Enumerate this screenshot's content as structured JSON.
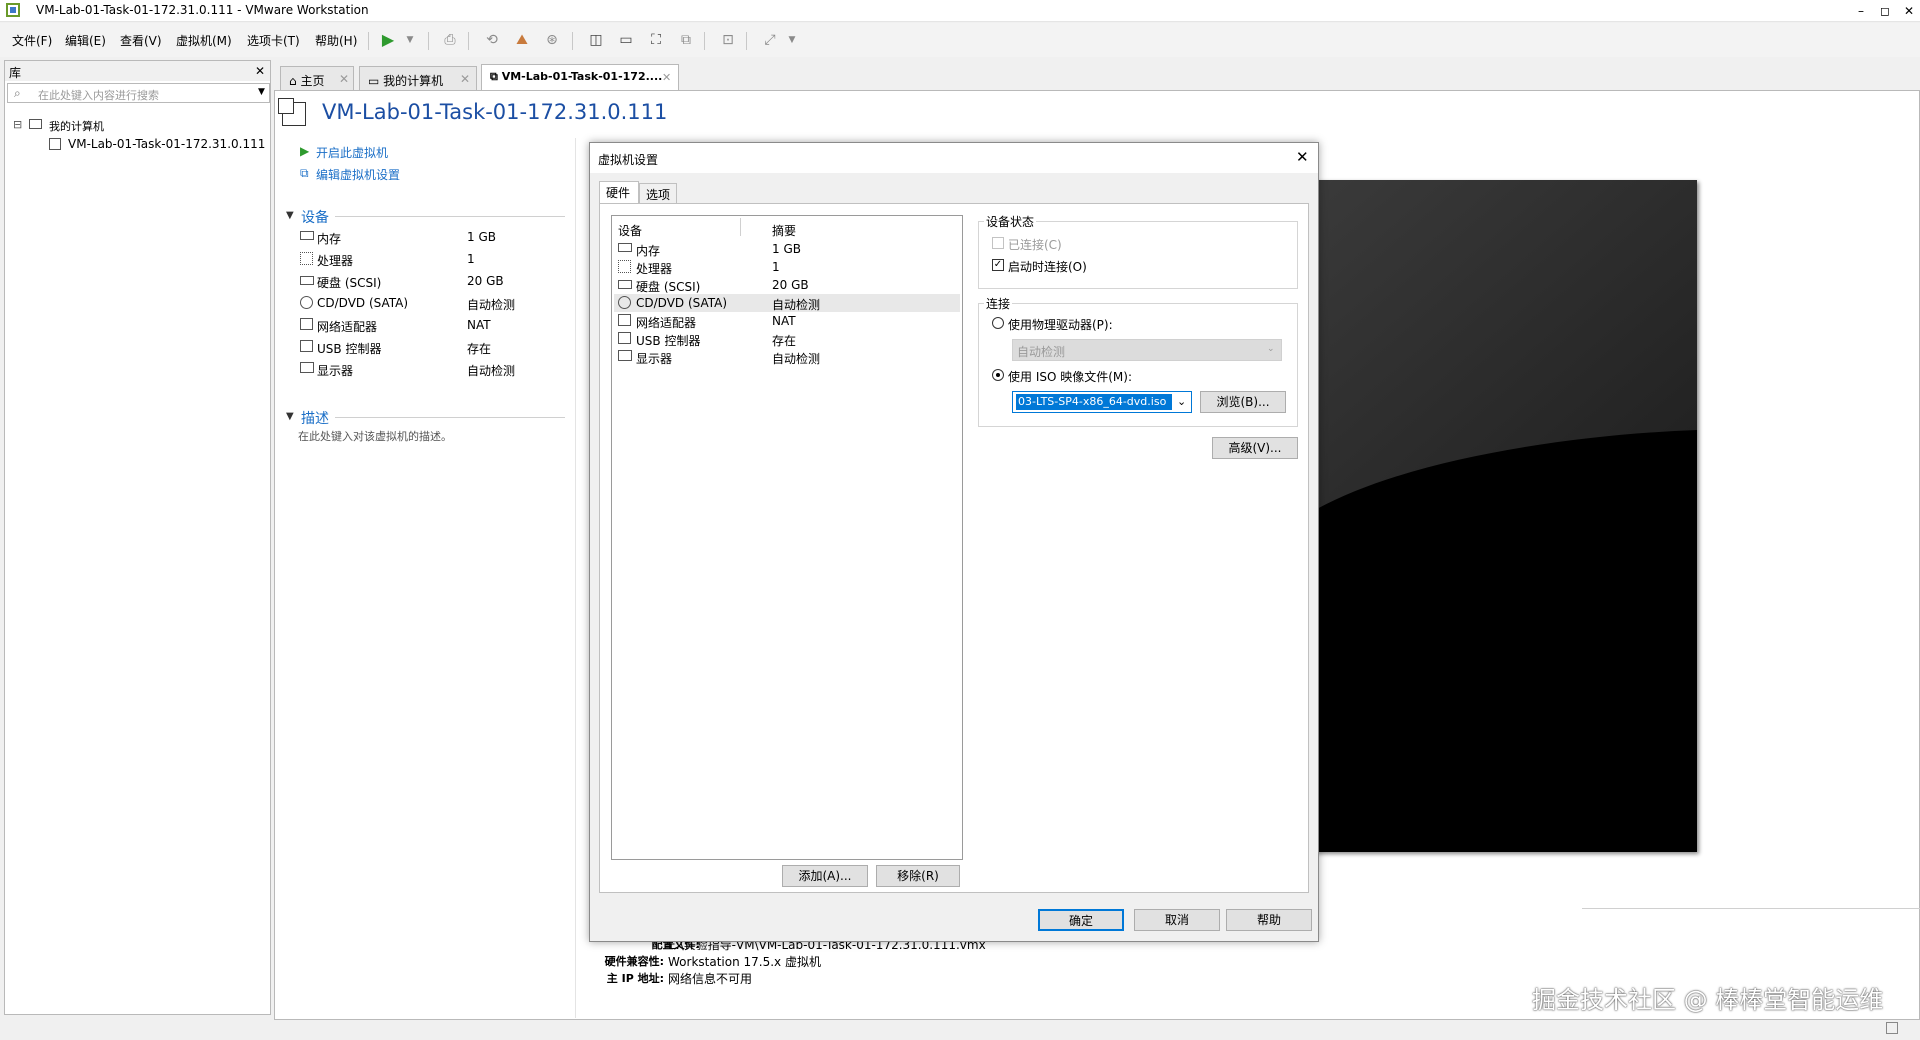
{
  "window": {
    "title": "VM-Lab-01-Task-01-172.31.0.111 - VMware Workstation",
    "controls": {
      "minimize": "–",
      "maximize": "◻",
      "close": "✕"
    }
  },
  "menubar": {
    "items": [
      "文件(F)",
      "编辑(E)",
      "查看(V)",
      "虚拟机(M)",
      "选项卡(T)",
      "帮助(H)"
    ]
  },
  "library": {
    "title": "库",
    "close": "✕",
    "search_placeholder": "在此处键入内容进行搜索",
    "tree": {
      "root": "我的计算机",
      "expander": "⊟",
      "children": [
        "VM-Lab-01-Task-01-172.31.0.111"
      ]
    }
  },
  "tabs": [
    {
      "label": "主页",
      "close": "✕"
    },
    {
      "label": "我的计算机",
      "close": "✕"
    },
    {
      "label": "VM-Lab-01-Task-01-172....",
      "close": "✕"
    }
  ],
  "vm": {
    "name": "VM-Lab-01-Task-01-172.31.0.111",
    "actions": {
      "power_on": "开启此虚拟机",
      "edit_settings": "编辑虚拟机设置"
    },
    "devices_header": "设备",
    "devices": [
      {
        "name": "内存",
        "value": "1 GB"
      },
      {
        "name": "处理器",
        "value": "1"
      },
      {
        "name": "硬盘 (SCSI)",
        "value": "20 GB"
      },
      {
        "name": "CD/DVD (SATA)",
        "value": "自动检测"
      },
      {
        "name": "网络适配器",
        "value": "NAT"
      },
      {
        "name": "USB 控制器",
        "value": "存在"
      },
      {
        "name": "显示器",
        "value": "自动检测"
      }
    ],
    "description_header": "描述",
    "description_placeholder": "在此处键入对该虚拟机的描述。",
    "details": [
      {
        "label": "配置文件:",
        "value": "E:\\实验指导-VM\\VM-Lab-01-Task-01-172.31.0.111.vmx"
      },
      {
        "label": "硬件兼容性:",
        "value": "Workstation 17.5.x 虚拟机"
      },
      {
        "label": "主 IP 地址:",
        "value": "网络信息不可用"
      }
    ]
  },
  "dialog": {
    "title": "虚拟机设置",
    "close": "✕",
    "tabs": [
      "硬件",
      "选项"
    ],
    "columns": {
      "device": "设备",
      "summary": "摘要"
    },
    "devices": [
      {
        "name": "内存",
        "summary": "1 GB"
      },
      {
        "name": "处理器",
        "summary": "1"
      },
      {
        "name": "硬盘 (SCSI)",
        "summary": "20 GB"
      },
      {
        "name": "CD/DVD (SATA)",
        "summary": "自动检测"
      },
      {
        "name": "网络适配器",
        "summary": "NAT"
      },
      {
        "name": "USB 控制器",
        "summary": "存在"
      },
      {
        "name": "显示器",
        "summary": "自动检测"
      }
    ],
    "selected_device_index": 3,
    "add_button": "添加(A)...",
    "remove_button": "移除(R)",
    "device_status": {
      "label": "设备状态",
      "connected": {
        "label": "已连接(C)",
        "checked": false,
        "enabled": false
      },
      "connect_at_power_on": {
        "label": "启动时连接(O)",
        "checked": true
      }
    },
    "connection": {
      "label": "连接",
      "physical_drive": {
        "label": "使用物理驱动器(P):",
        "selected": false
      },
      "physical_drive_value": "自动检测",
      "iso": {
        "label": "使用 ISO 映像文件(M):",
        "selected": true
      },
      "iso_value": "03-LTS-SP4-x86_64-dvd.iso",
      "browse_button": "浏览(B)..."
    },
    "advanced_button": "高级(V)...",
    "ok_button": "确定",
    "cancel_button": "取消",
    "help_button": "帮助"
  },
  "watermark": "掘金技术社区 @ 棒棒堂智能运维"
}
